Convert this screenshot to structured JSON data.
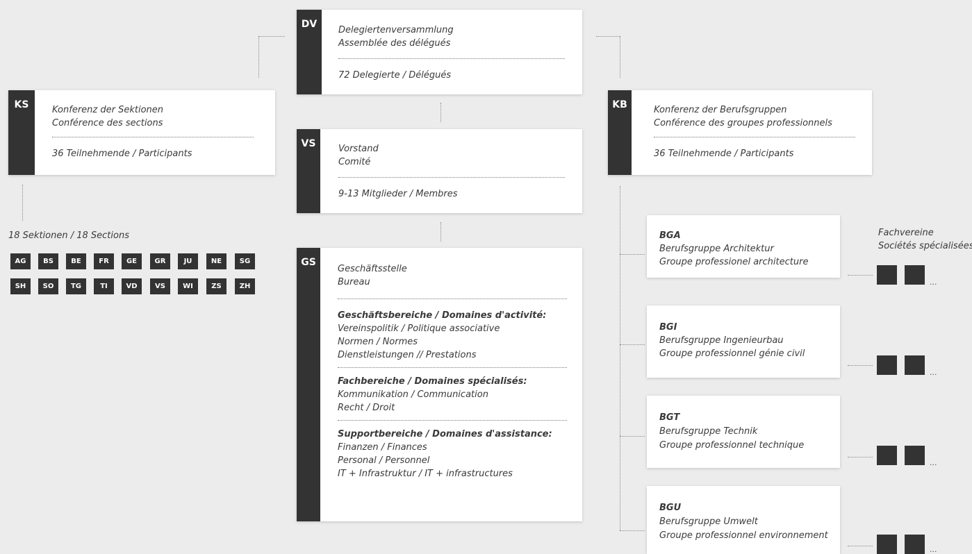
{
  "dv": {
    "code": "DV",
    "line1": "Delegiertenversammlung",
    "line2": "Assemblée des délégués",
    "count": "72 Delegierte / Délégués"
  },
  "ks": {
    "code": "KS",
    "line1": "Konferenz der Sektionen",
    "line2": "Conférence des sections",
    "count": "36 Teilnehmende / Participants"
  },
  "kb": {
    "code": "KB",
    "line1": "Konferenz der Berufsgruppen",
    "line2": "Conférence des groupes professionnels",
    "count": "36 Teilnehmende / Participants"
  },
  "vs": {
    "code": "VS",
    "line1": "Vorstand",
    "line2": "Comité",
    "count": "9-13 Mitglieder / Membres"
  },
  "gs": {
    "code": "GS",
    "line1": "Geschäftsstelle",
    "line2": "Bureau",
    "sections": [
      {
        "heading": "Geschäftsbereiche / Domaines d'activité:",
        "items": [
          "Vereinspolitik / Politique associative",
          "Normen / Normes",
          "Dienstleistungen // Prestations"
        ]
      },
      {
        "heading": "Fachbereiche / Domaines spécialisés:",
        "items": [
          "Kommunikation / Communication",
          "Recht / Droit"
        ]
      },
      {
        "heading": "Supportbereiche / Domaines d'assistance:",
        "items": [
          "Finanzen / Finances",
          "Personal / Personnel",
          "IT + Infrastruktur / IT + infrastructures"
        ]
      }
    ]
  },
  "sections": {
    "label": "18 Sektionen / 18 Sections",
    "row1": [
      "AG",
      "BS",
      "BE",
      "FR",
      "GE",
      "GR",
      "JU",
      "NE",
      "SG"
    ],
    "row2": [
      "SH",
      "SO",
      "TG",
      "TI",
      "VD",
      "VS",
      "WI",
      "ZS",
      "ZH"
    ]
  },
  "fachvereine": {
    "line1": "Fachvereine",
    "line2": "Sociétés spécialisées",
    "ellipsis": "..."
  },
  "groups": [
    {
      "code": "BGA",
      "line1": "Berufsgruppe Architektur",
      "line2": "Groupe professionel architecture"
    },
    {
      "code": "BGI",
      "line1": "Berufsgruppe Ingenieurbau",
      "line2": "Groupe professionnel génie civil"
    },
    {
      "code": "BGT",
      "line1": "Berufsgruppe Technik",
      "line2": "Groupe professionnel technique"
    },
    {
      "code": "BGU",
      "line1": "Berufsgruppe Umwelt",
      "line2": "Groupe professionnel environnement"
    }
  ],
  "colors": {
    "tag": "#333333",
    "background": "#ececec",
    "card": "#ffffff"
  }
}
